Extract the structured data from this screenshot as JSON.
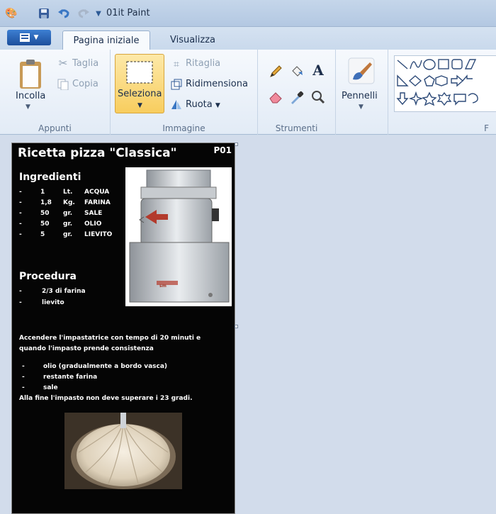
{
  "window": {
    "title": "01it  Paint"
  },
  "tabs": {
    "menu": "",
    "home": "Pagina iniziale",
    "view": "Visualizza"
  },
  "ribbon": {
    "clipboard": {
      "paste": "Incolla",
      "cut": "Taglia",
      "copy": "Copia",
      "group": "Appunti"
    },
    "image": {
      "select": "Seleziona",
      "crop": "Ritaglia",
      "resize": "Ridimensiona",
      "rotate": "Ruota",
      "group": "Immagine"
    },
    "tools": {
      "group": "Strumenti"
    },
    "brushes": {
      "label": "Pennelli"
    },
    "shapes": {
      "group": "F"
    }
  },
  "document": {
    "title": "Ricetta pizza \"Classica\"",
    "code": "P01",
    "ingredients_title": "Ingredienti",
    "ingredients": [
      {
        "dash": "-",
        "qty": "1",
        "unit": "Lt.",
        "name": "ACQUA"
      },
      {
        "dash": "-",
        "qty": "1,8",
        "unit": "Kg.",
        "name": "FARINA"
      },
      {
        "dash": "-",
        "qty": "50",
        "unit": "gr.",
        "name": "SALE"
      },
      {
        "dash": "-",
        "qty": "50",
        "unit": "gr.",
        "name": "OLIO"
      },
      {
        "dash": "-",
        "qty": "5",
        "unit": "gr.",
        "name": "LIEVITO"
      }
    ],
    "procedure_title": "Procedura",
    "procedure": [
      {
        "dash": "-",
        "text": "2/3 di farina"
      },
      {
        "dash": "-",
        "text": "lievito"
      }
    ],
    "paragraph1": "Accendere l'impastatrice con tempo di 20 minuti e",
    "paragraph2": "quando l'impasto prende consistenza",
    "steps": [
      {
        "dash": "-",
        "text": "olio (gradualmente a bordo vasca)"
      },
      {
        "dash": "-",
        "text": "restante farina"
      },
      {
        "dash": "-",
        "text": "sale"
      }
    ],
    "final": "Alla fine l'impasto non deve superare i 23 gradi.",
    "mixer_brand": "sm"
  }
}
